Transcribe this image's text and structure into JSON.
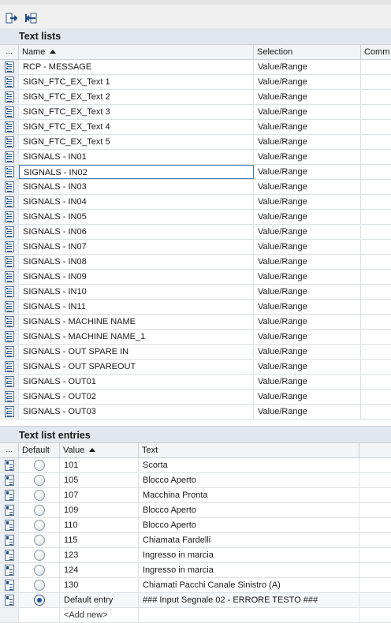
{
  "toolbar": {
    "buttons": [
      "export-icon",
      "import-icon"
    ]
  },
  "text_lists": {
    "title": "Text lists",
    "columns": {
      "ind": "...",
      "name": "Name",
      "selection": "Selection",
      "comment": "Comm"
    },
    "rows": [
      {
        "name": "RCP - MESSAGE",
        "selection": "Value/Range"
      },
      {
        "name": "SIGN_FTC_EX_Text 1",
        "selection": "Value/Range"
      },
      {
        "name": "SIGN_FTC_EX_Text 2",
        "selection": "Value/Range"
      },
      {
        "name": "SIGN_FTC_EX_Text 3",
        "selection": "Value/Range"
      },
      {
        "name": "SIGN_FTC_EX_Text 4",
        "selection": "Value/Range"
      },
      {
        "name": "SIGN_FTC_EX_Text 5",
        "selection": "Value/Range"
      },
      {
        "name": "SIGNALS - IN01",
        "selection": "Value/Range"
      },
      {
        "name": "SIGNALS - IN02",
        "selection": "Value/Range",
        "selected": true
      },
      {
        "name": "SIGNALS - IN03",
        "selection": "Value/Range"
      },
      {
        "name": "SIGNALS - IN04",
        "selection": "Value/Range"
      },
      {
        "name": "SIGNALS - IN05",
        "selection": "Value/Range"
      },
      {
        "name": "SIGNALS - IN06",
        "selection": "Value/Range"
      },
      {
        "name": "SIGNALS - IN07",
        "selection": "Value/Range"
      },
      {
        "name": "SIGNALS - IN08",
        "selection": "Value/Range"
      },
      {
        "name": "SIGNALS - IN09",
        "selection": "Value/Range"
      },
      {
        "name": "SIGNALS - IN10",
        "selection": "Value/Range"
      },
      {
        "name": "SIGNALS - IN11",
        "selection": "Value/Range"
      },
      {
        "name": "SIGNALS - MACHINE NAME",
        "selection": "Value/Range"
      },
      {
        "name": "SIGNALS - MACHINE NAME_1",
        "selection": "Value/Range"
      },
      {
        "name": "SIGNALS - OUT SPARE IN",
        "selection": "Value/Range"
      },
      {
        "name": "SIGNALS - OUT SPAREOUT",
        "selection": "Value/Range"
      },
      {
        "name": "SIGNALS - OUT01",
        "selection": "Value/Range"
      },
      {
        "name": "SIGNALS - OUT02",
        "selection": "Value/Range"
      },
      {
        "name": "SIGNALS - OUT03",
        "selection": "Value/Range"
      }
    ]
  },
  "entries": {
    "title": "Text list entries",
    "columns": {
      "ind": "...",
      "default": "Default",
      "value": "Value",
      "text": "Text"
    },
    "rows": [
      {
        "value": "101",
        "text": "Scorta",
        "default": false
      },
      {
        "value": "105",
        "text": "Blocco Aperto",
        "default": false
      },
      {
        "value": "107",
        "text": "Macchina Pronta",
        "default": false
      },
      {
        "value": "109",
        "text": "Blocco Aperto",
        "default": false
      },
      {
        "value": "110",
        "text": "Blocco Aperto",
        "default": false
      },
      {
        "value": "115",
        "text": "Chiamata Fardelli",
        "default": false
      },
      {
        "value": "123",
        "text": "Ingresso in marcia",
        "default": false
      },
      {
        "value": "124",
        "text": "Ingresso in marcia",
        "default": false
      },
      {
        "value": "130",
        "text": "Chiamati Pacchi Canale Sinistro (A)",
        "default": false
      },
      {
        "value": "Default entry",
        "text": "### Input Segnale 02 - ERRORE TESTO ###",
        "default": true
      }
    ],
    "add_new": "<Add new>"
  },
  "colors": {
    "accent": "#3d78b5",
    "header_bg": "#e1e7ec",
    "radio_on": "#1f4e9a"
  }
}
